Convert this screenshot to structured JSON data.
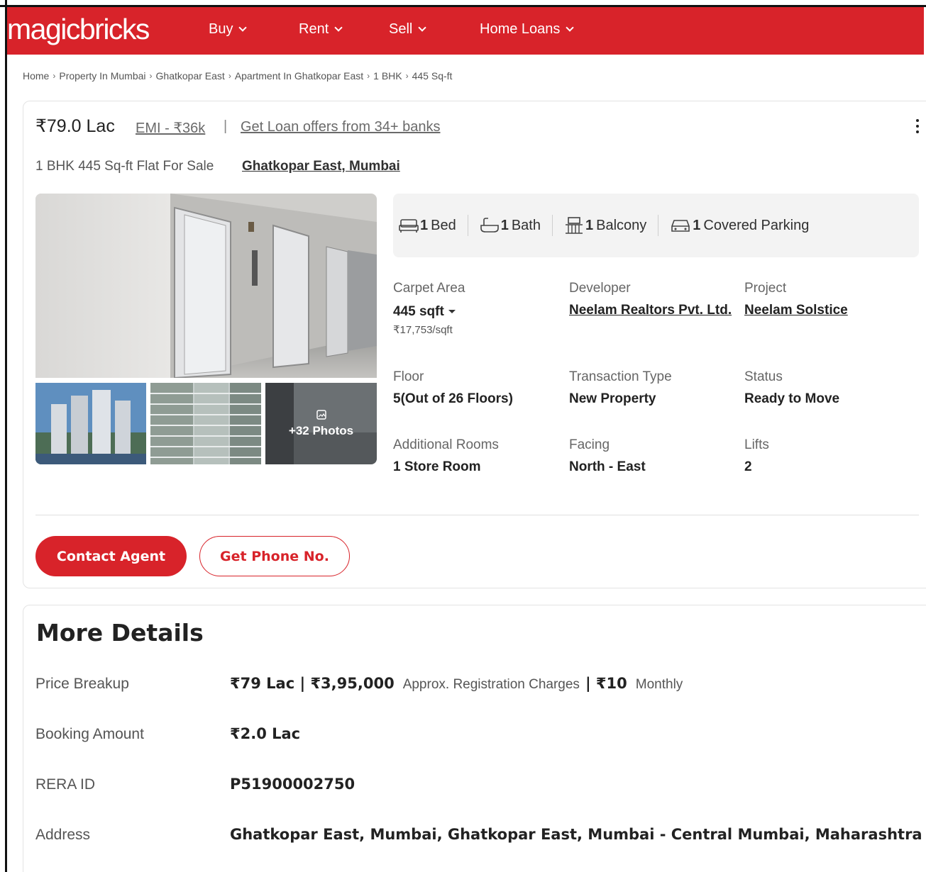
{
  "header": {
    "logo": "magicbricks",
    "nav": [
      {
        "label": "Buy"
      },
      {
        "label": "Rent"
      },
      {
        "label": "Sell"
      },
      {
        "label": "Home Loans"
      }
    ],
    "accent": "#d8232a"
  },
  "breadcrumb": [
    "Home",
    "Property In Mumbai",
    "Ghatkopar East",
    "Apartment In Ghatkopar East",
    "1 BHK",
    "445 Sq-ft"
  ],
  "listing": {
    "price": "₹79.0 Lac",
    "emi": "EMI - ₹36k",
    "separator": "|",
    "loan_offer": "Get Loan offers from 34+ banks",
    "subtitle": "1 BHK 445 Sq-ft Flat For Sale",
    "locality": "Ghatkopar East, Mumbai",
    "photos_more": "+32 Photos",
    "amenities": [
      {
        "count": "1",
        "label": "Bed",
        "icon": "bed-icon"
      },
      {
        "count": "1",
        "label": "Bath",
        "icon": "bath-icon"
      },
      {
        "count": "1",
        "label": "Balcony",
        "icon": "balcony-icon"
      },
      {
        "count": "1",
        "label": "Covered Parking",
        "icon": "car-icon"
      }
    ],
    "specs": {
      "carpet_area": {
        "label": "Carpet Area",
        "value": "445 sqft",
        "sub": "₹17,753/sqft"
      },
      "developer": {
        "label": "Developer",
        "value": "Neelam Realtors Pvt. Ltd."
      },
      "project": {
        "label": "Project",
        "value": "Neelam Solstice"
      },
      "floor": {
        "label": "Floor",
        "value": "5(Out of 26 Floors)"
      },
      "transaction": {
        "label": "Transaction Type",
        "value": "New Property"
      },
      "status": {
        "label": "Status",
        "value": "Ready to Move"
      },
      "additional_rooms": {
        "label": "Additional Rooms",
        "value": "1 Store Room"
      },
      "facing": {
        "label": "Facing",
        "value": "North - East"
      },
      "lifts": {
        "label": "Lifts",
        "value": "2"
      }
    },
    "contact_label": "Contact Agent",
    "phone_label": "Get Phone No."
  },
  "more_details": {
    "title": "More Details",
    "price_breakup": {
      "label": "Price Breakup",
      "price": "₹79 Lac | ₹3,95,000",
      "reg_text": "Approx. Registration Charges",
      "monthly": "| ₹10",
      "monthly_text": "Monthly"
    },
    "booking": {
      "label": "Booking Amount",
      "value": "₹2.0 Lac"
    },
    "rera": {
      "label": "RERA ID",
      "value": "P51900002750"
    },
    "address": {
      "label": "Address",
      "value": "Ghatkopar East, Mumbai, Ghatkopar East, Mumbai - Central Mumbai, Maharashtra"
    }
  }
}
